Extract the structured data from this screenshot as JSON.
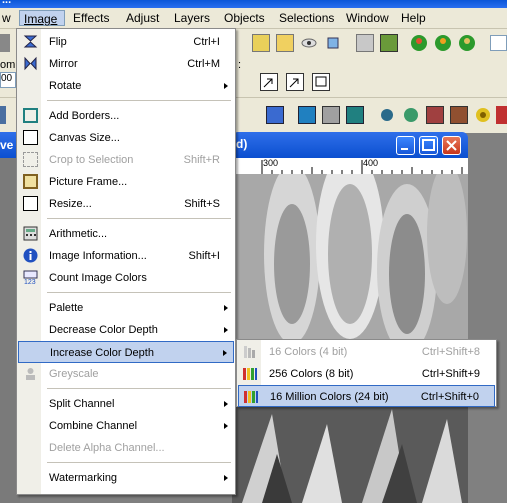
{
  "window_title": "...",
  "menubar": [
    {
      "label": "w"
    },
    {
      "label": "Image"
    },
    {
      "label": "Effects"
    },
    {
      "label": "Adjust"
    },
    {
      "label": "Layers"
    },
    {
      "label": "Objects"
    },
    {
      "label": "Selections"
    },
    {
      "label": "Window"
    },
    {
      "label": "Help"
    }
  ],
  "toolbar": {
    "zoom_label": "om",
    "zoom_value": "00",
    "colon": ":"
  },
  "image_window": {
    "title_partial": "d)",
    "left_title_partial": "ve",
    "ruler_300": "300",
    "ruler_400": "400"
  },
  "image_menu": {
    "items": [
      {
        "label": "Flip",
        "shortcut": "Ctrl+I"
      },
      {
        "label": "Mirror",
        "shortcut": "Ctrl+M"
      },
      {
        "label": "Rotate",
        "shortcut": ""
      },
      {
        "label": "Add Borders...",
        "shortcut": ""
      },
      {
        "label": "Canvas Size...",
        "shortcut": ""
      },
      {
        "label": "Crop to Selection",
        "shortcut": "Shift+R"
      },
      {
        "label": "Picture Frame...",
        "shortcut": ""
      },
      {
        "label": "Resize...",
        "shortcut": "Shift+S"
      },
      {
        "label": "Arithmetic...",
        "shortcut": ""
      },
      {
        "label": "Image Information...",
        "shortcut": "Shift+I"
      },
      {
        "label": "Count Image Colors",
        "shortcut": ""
      },
      {
        "label": "Palette",
        "shortcut": ""
      },
      {
        "label": "Decrease Color Depth",
        "shortcut": ""
      },
      {
        "label": "Increase Color Depth",
        "shortcut": ""
      },
      {
        "label": "Greyscale",
        "shortcut": ""
      },
      {
        "label": "Split Channel",
        "shortcut": ""
      },
      {
        "label": "Combine Channel",
        "shortcut": ""
      },
      {
        "label": "Delete Alpha Channel...",
        "shortcut": ""
      },
      {
        "label": "Watermarking",
        "shortcut": ""
      }
    ]
  },
  "submenu": {
    "items": [
      {
        "label": "16 Colors (4 bit)",
        "shortcut": "Ctrl+Shift+8"
      },
      {
        "label": "256 Colors (8 bit)",
        "shortcut": "Ctrl+Shift+9"
      },
      {
        "label": "16 Million Colors (24 bit)",
        "shortcut": "Ctrl+Shift+0"
      }
    ]
  },
  "colors": {
    "menu_highlight": "#c1d2ee",
    "highlight_border": "#316ac5",
    "disabled_text": "#a0a0a0",
    "title_blue": "#0b4fd0"
  }
}
